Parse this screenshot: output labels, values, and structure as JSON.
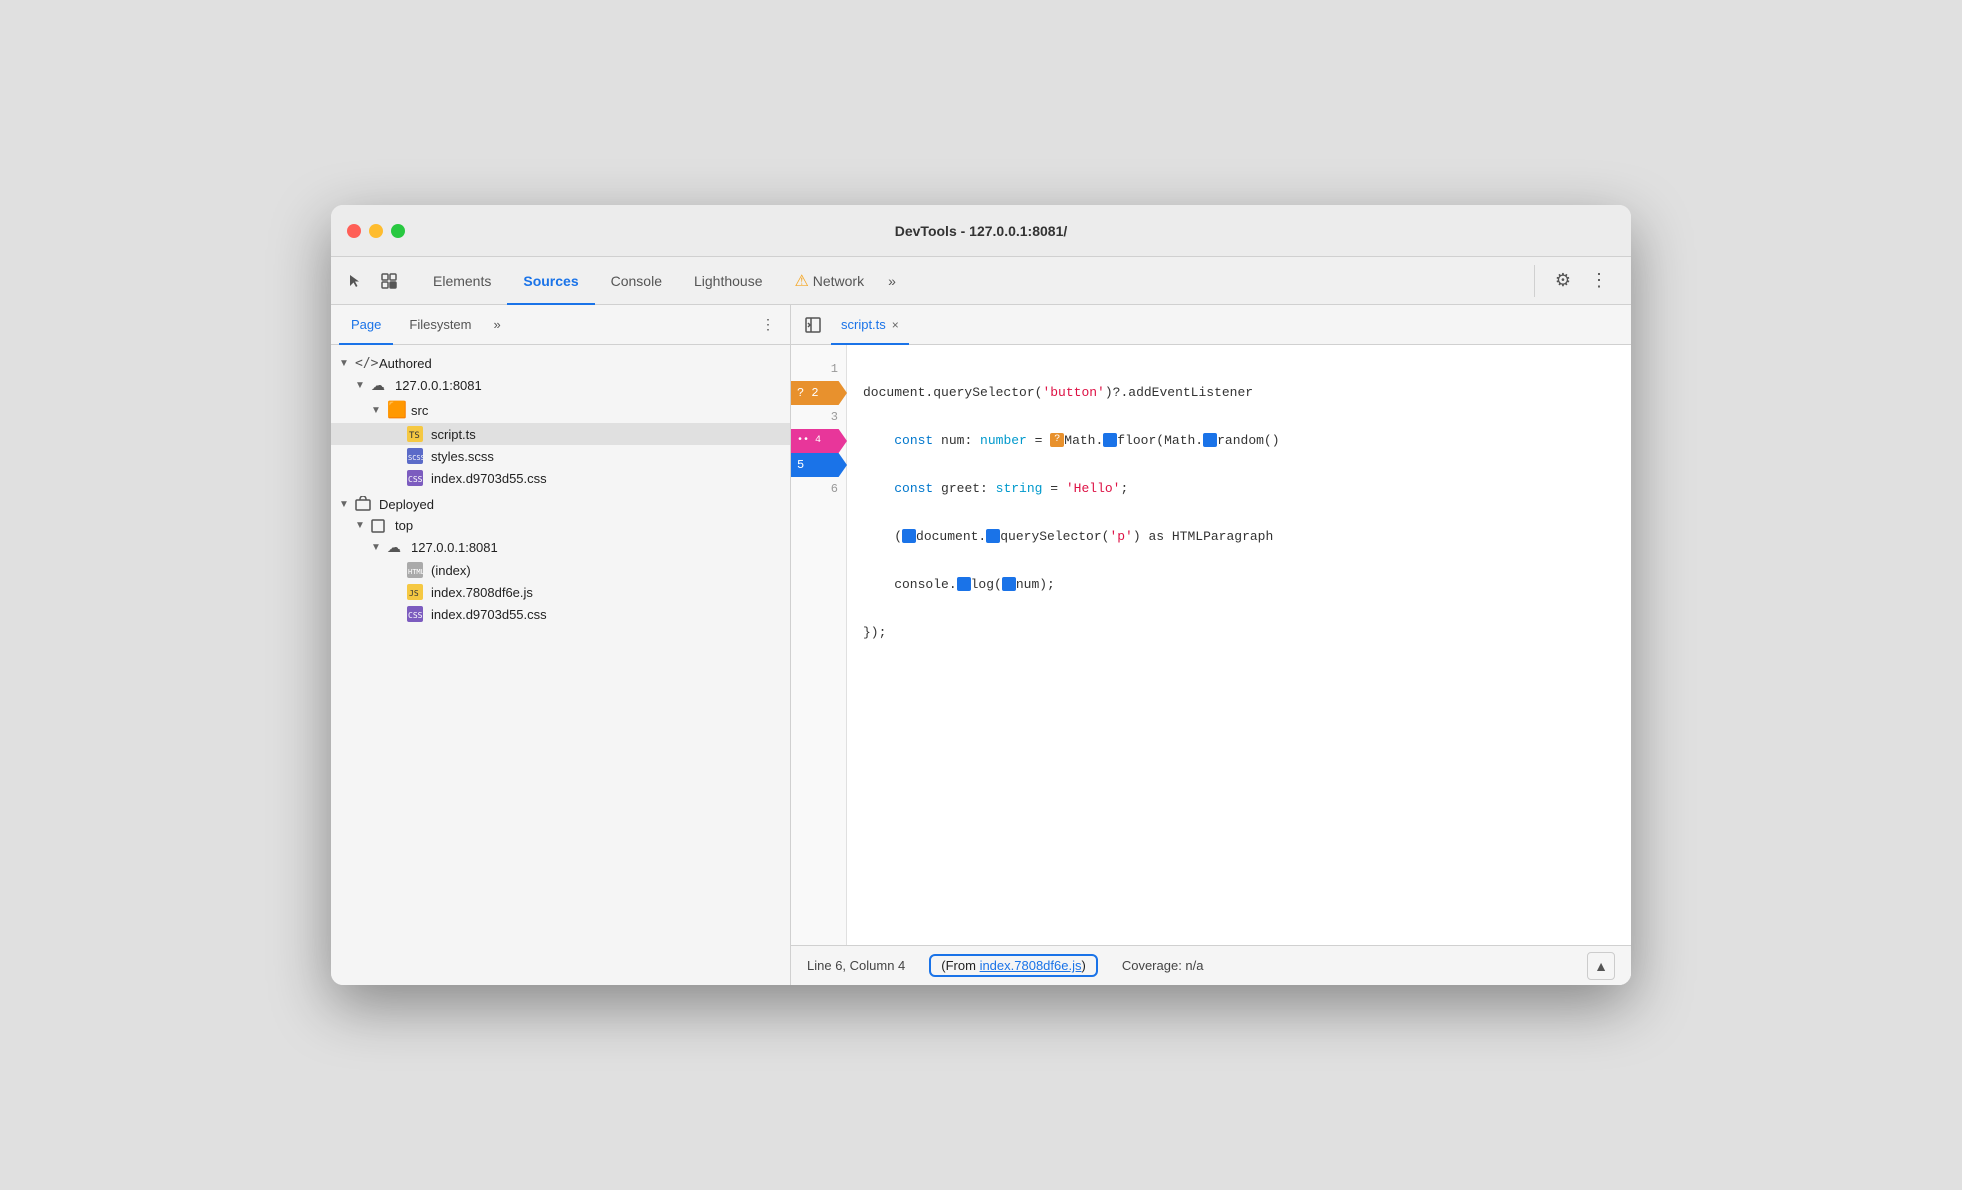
{
  "window": {
    "title": "DevTools - 127.0.0.1:8081/"
  },
  "toolbar": {
    "tabs": [
      {
        "id": "elements",
        "label": "Elements",
        "active": false
      },
      {
        "id": "sources",
        "label": "Sources",
        "active": true
      },
      {
        "id": "console",
        "label": "Console",
        "active": false
      },
      {
        "id": "lighthouse",
        "label": "Lighthouse",
        "active": false
      },
      {
        "id": "network",
        "label": "Network",
        "active": false
      }
    ],
    "more_label": "»",
    "settings_icon": "⚙",
    "dots_icon": "⋮",
    "warning_icon": "⚠"
  },
  "left_panel": {
    "sub_tabs": [
      {
        "id": "page",
        "label": "Page",
        "active": true
      },
      {
        "id": "filesystem",
        "label": "Filesystem",
        "active": false
      }
    ],
    "more_label": "»",
    "dots_icon": "⋮",
    "tree": [
      {
        "id": "authored",
        "type": "section",
        "indent": 0,
        "arrow": "▼",
        "icon": "</>",
        "label": "Authored",
        "icon_type": "code"
      },
      {
        "id": "server1",
        "type": "server",
        "indent": 1,
        "arrow": "▼",
        "icon": "☁",
        "label": "127.0.0.1:8081",
        "icon_type": "cloud"
      },
      {
        "id": "src",
        "type": "folder",
        "indent": 2,
        "arrow": "▼",
        "icon": "📁",
        "label": "src",
        "icon_type": "folder"
      },
      {
        "id": "script_ts",
        "type": "file",
        "indent": 3,
        "arrow": "",
        "icon": "📄",
        "label": "script.ts",
        "icon_type": "ts",
        "selected": true
      },
      {
        "id": "styles_scss",
        "type": "file",
        "indent": 3,
        "arrow": "",
        "icon": "📄",
        "label": "styles.scss",
        "icon_type": "scss"
      },
      {
        "id": "index_css1",
        "type": "file",
        "indent": 3,
        "arrow": "",
        "icon": "📄",
        "label": "index.d9703d55.css",
        "icon_type": "css"
      },
      {
        "id": "deployed",
        "type": "section",
        "indent": 0,
        "arrow": "▼",
        "icon": "📦",
        "label": "Deployed",
        "icon_type": "box"
      },
      {
        "id": "top",
        "type": "server",
        "indent": 1,
        "arrow": "▼",
        "icon": "□",
        "label": "top",
        "icon_type": "box-outline"
      },
      {
        "id": "server2",
        "type": "server",
        "indent": 2,
        "arrow": "▼",
        "icon": "☁",
        "label": "127.0.0.1:8081",
        "icon_type": "cloud"
      },
      {
        "id": "index_html",
        "type": "file",
        "indent": 3,
        "arrow": "",
        "icon": "📄",
        "label": "(index)",
        "icon_type": "html"
      },
      {
        "id": "index_js",
        "type": "file",
        "indent": 3,
        "arrow": "",
        "icon": "📄",
        "label": "index.7808df6e.js",
        "icon_type": "js"
      },
      {
        "id": "index_css2",
        "type": "file",
        "indent": 3,
        "arrow": "",
        "icon": "📄",
        "label": "index.d9703d55.css",
        "icon_type": "css"
      }
    ]
  },
  "editor": {
    "tab_label": "script.ts",
    "tab_close": "×",
    "lines": [
      {
        "num": 1,
        "badge": null,
        "code_html": "document.querySelector(<span class='c-string'>'button'</span>)?.<span class='c-method'>addEventListener</span>"
      },
      {
        "num": 2,
        "badge": "question",
        "code_html": "    <span class='c-keyword'>const</span> <span class='c-default'>num</span>: <span class='c-type'>number</span> = <span class='inline-icon-orange'>?</span><span class='c-default'>Math.</span><span class='inline-icon'>▷</span><span class='c-default'>floor(Math.</span><span class='inline-icon'>▷</span><span class='c-default'>random()</span>"
      },
      {
        "num": 3,
        "badge": null,
        "code_html": "    <span class='c-keyword'>const</span> <span class='c-default'>greet</span>: <span class='c-type'>string</span> = <span class='c-string'>'Hello'</span>;"
      },
      {
        "num": 4,
        "badge": "dotdot",
        "code_html": "    (<span class='inline-icon'>▷</span><span class='c-default'>document.</span><span class='inline-icon'>▷</span><span class='c-default'>querySelector(<span class='c-string'>'p'</span>) as HTMLParagraph</span>"
      },
      {
        "num": 5,
        "badge": "blue",
        "code_html": "    <span class='c-default'>console.</span><span class='inline-icon'>▷</span><span class='c-default'>log(</span><span class='inline-icon'>▷</span><span class='c-default'>num);</span>"
      },
      {
        "num": 6,
        "badge": null,
        "code_html": "<span class='c-default'>});</span>"
      }
    ]
  },
  "status_bar": {
    "position": "Line 6, Column 4",
    "source_prefix": "(From ",
    "source_link": "index.7808df6e.js",
    "source_suffix": ")",
    "coverage": "Coverage: n/a",
    "icon": "▲"
  },
  "icons": {
    "cursor": "↖",
    "inspector": "⧉",
    "dots": "⋮",
    "chevrons": "»",
    "gear": "⚙",
    "warning": "⚠"
  }
}
